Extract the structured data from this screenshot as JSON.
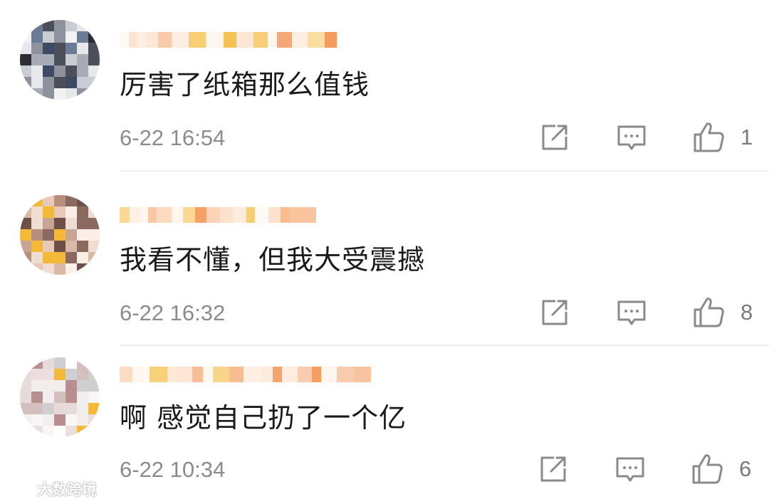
{
  "comments": [
    {
      "username": "",
      "text": "厉害了纸箱那么值钱",
      "time": "6-22 16:54",
      "likes": "1"
    },
    {
      "username": "",
      "text": "我看不懂，但我大受震撼",
      "time": "6-22 16:32",
      "likes": "8"
    },
    {
      "username": "",
      "text": "啊 感觉自己扔了一个亿",
      "time": "6-22 10:34",
      "likes": "6"
    }
  ],
  "icons": {
    "share": "share-icon",
    "reply": "comment-icon",
    "like": "thumbs-up-icon"
  },
  "colors": {
    "text": "#1a1a1a",
    "meta": "#8c8c8c",
    "icon": "#8a8a8a",
    "username_blur_orange": "#f7b07a",
    "username_blur_yellow": "#f5b93a"
  },
  "watermark": {
    "text": "大数跨境"
  }
}
